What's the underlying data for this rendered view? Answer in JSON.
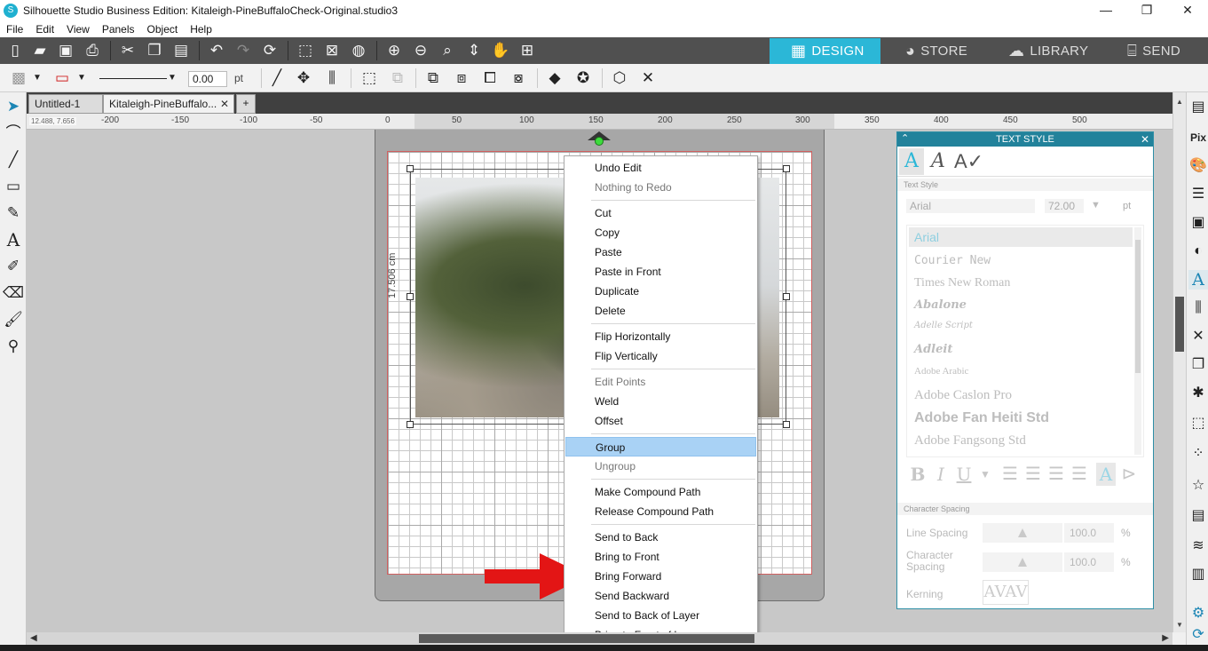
{
  "window": {
    "title": "Silhouette Studio Business Edition: Kitaleigh-PineBuffaloCheck-Original.studio3",
    "minimize": "—",
    "restore": "❐",
    "close": "✕"
  },
  "menu": [
    "File",
    "Edit",
    "View",
    "Panels",
    "Object",
    "Help"
  ],
  "nav_tabs": {
    "design": "DESIGN",
    "store": "STORE",
    "library": "LIBRARY",
    "send": "SEND"
  },
  "stroke": {
    "value": "0.00",
    "unit": "pt"
  },
  "doc_tabs": [
    {
      "label": "Untitled-1"
    },
    {
      "label": "Kitaleigh-PineBuffalo..."
    }
  ],
  "doc_tab_add": "+",
  "ruler": {
    "coords": "12.488, 7.656",
    "labels": [
      "-200",
      "-150",
      "-100",
      "-50",
      "0",
      "50",
      "100",
      "150",
      "200",
      "250",
      "300",
      "350",
      "400",
      "450",
      "500"
    ]
  },
  "dimension_label": "17.506 cm",
  "context_menu": {
    "items": [
      {
        "label": "Undo Edit",
        "enabled": true
      },
      {
        "label": "Nothing to Redo",
        "enabled": false
      },
      {
        "label": "Cut",
        "enabled": true
      },
      {
        "label": "Copy",
        "enabled": true
      },
      {
        "label": "Paste",
        "enabled": true
      },
      {
        "label": "Paste in Front",
        "enabled": true
      },
      {
        "label": "Duplicate",
        "enabled": true
      },
      {
        "label": "Delete",
        "enabled": true
      },
      {
        "label": "Flip Horizontally",
        "enabled": true
      },
      {
        "label": "Flip Vertically",
        "enabled": true
      },
      {
        "label": "Edit Points",
        "enabled": false
      },
      {
        "label": "Weld",
        "enabled": true
      },
      {
        "label": "Offset",
        "enabled": true
      },
      {
        "label": "Group",
        "enabled": true,
        "highlighted": true
      },
      {
        "label": "Ungroup",
        "enabled": false
      },
      {
        "label": "Make Compound Path",
        "enabled": true
      },
      {
        "label": "Release Compound Path",
        "enabled": true
      },
      {
        "label": "Send to Back",
        "enabled": true
      },
      {
        "label": "Bring to Front",
        "enabled": true
      },
      {
        "label": "Bring Forward",
        "enabled": true
      },
      {
        "label": "Send Backward",
        "enabled": true
      },
      {
        "label": "Send to Back of Layer",
        "enabled": true
      },
      {
        "label": "Bring to Front of Layer",
        "enabled": true
      }
    ]
  },
  "text_style_panel": {
    "title": "TEXT STYLE",
    "section_text_style": "Text Style",
    "font_field": "Arial",
    "size_field": "72.00",
    "size_unit": "pt",
    "fonts": [
      "Arial",
      "Courier New",
      "Times New Roman",
      "Abalone",
      "Adelle Script",
      "Adleit",
      "Adobe Arabic",
      "Adobe Caslon Pro",
      "Adobe Fan Heiti Std",
      "Adobe Fangsong Std"
    ],
    "format_buttons": [
      "B",
      "I",
      "U"
    ],
    "section_char_spacing": "Character Spacing",
    "line_spacing_label": "Line Spacing",
    "line_spacing_value": "100.0",
    "char_spacing_label": "Character Spacing",
    "char_spacing_value": "100.0",
    "pct": "%",
    "kerning_label": "Kerning",
    "kerning_sample": "AVAV"
  },
  "colors": {
    "toolbar_dark": "#505050",
    "design_tab": "#2bb7d7",
    "panel_header": "#22829b",
    "menu_highlight": "#a9d2f5",
    "arrow_red": "#e31515"
  }
}
